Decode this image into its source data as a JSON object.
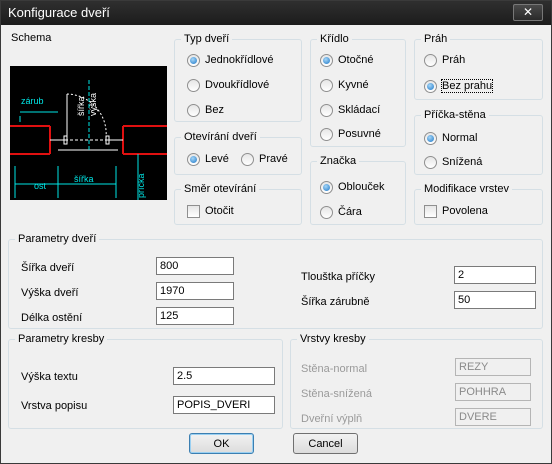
{
  "window": {
    "title": "Konfigurace dveří",
    "close_glyph": "✕"
  },
  "schema": {
    "title": "Schema",
    "labels": {
      "zarub": "zárub",
      "sirka_v": "šířka",
      "vyska": "výška",
      "ost": "ost",
      "sirka_h": "šířka",
      "pricka": "příčka"
    }
  },
  "typ_dveri": {
    "title": "Typ dveří",
    "options": [
      {
        "label": "Jednokřídlové",
        "selected": true
      },
      {
        "label": "Dvoukřídlové",
        "selected": false
      },
      {
        "label": "Bez",
        "selected": false
      }
    ]
  },
  "kridlo": {
    "title": "Křídlo",
    "options": [
      {
        "label": "Otočné",
        "selected": true
      },
      {
        "label": "Kyvné",
        "selected": false
      },
      {
        "label": "Skládací",
        "selected": false
      },
      {
        "label": "Posuvné",
        "selected": false
      }
    ]
  },
  "prah": {
    "title": "Práh",
    "options": [
      {
        "label": "Práh",
        "selected": false
      },
      {
        "label": "Bez prahu",
        "selected": true
      }
    ]
  },
  "otevirani": {
    "title": "Otevírání dveří",
    "options": [
      {
        "label": "Levé",
        "selected": true
      },
      {
        "label": "Pravé",
        "selected": false
      }
    ]
  },
  "pricka_stena": {
    "title": "Příčka-stěna",
    "options": [
      {
        "label": "Normal",
        "selected": true
      },
      {
        "label": "Snížená",
        "selected": false
      }
    ]
  },
  "smer": {
    "title": "Směr otevírání",
    "checkbox_label": "Otočit",
    "checked": false
  },
  "znacka": {
    "title": "Značka",
    "options": [
      {
        "label": "Oblouček",
        "selected": true
      },
      {
        "label": "Čára",
        "selected": false
      }
    ]
  },
  "modifikace": {
    "title": "Modifikace vrstev",
    "checkbox_label": "Povolena",
    "checked": false
  },
  "parametry_dveri": {
    "title": "Parametry dveří",
    "sirka_label": "Šířka dveří",
    "sirka_value": "800",
    "vyska_label": "Výška dveří",
    "vyska_value": "1970",
    "delka_label": "Délka ostění",
    "delka_value": "125",
    "tloustka_label": "Tlouštka příčky",
    "tloustka_value": "2",
    "zarubne_label": "Šířka zárubně",
    "zarubne_value": "50"
  },
  "parametry_kresby": {
    "title": "Parametry kresby",
    "vyska_textu_label": "Výška textu",
    "vyska_textu_value": "2.5",
    "vrstva_label": "Vrstva popisu",
    "vrstva_value": "POPIS_DVERI"
  },
  "vrstvy_kresby": {
    "title": "Vrstvy kresby",
    "stena_normal_label": "Stěna-normal",
    "stena_normal_value": "REZY",
    "stena_snizena_label": "Stěna-snížená",
    "stena_snizena_value": "POHHRA",
    "dverni_label": "Dveřní výplň",
    "dverni_value": "DVERE"
  },
  "buttons": {
    "ok": "OK",
    "cancel": "Cancel"
  },
  "colors": {
    "schema_bg": "#000000",
    "wall": "#e01010",
    "dim": "#00e5e5",
    "door": "#ffffff"
  }
}
